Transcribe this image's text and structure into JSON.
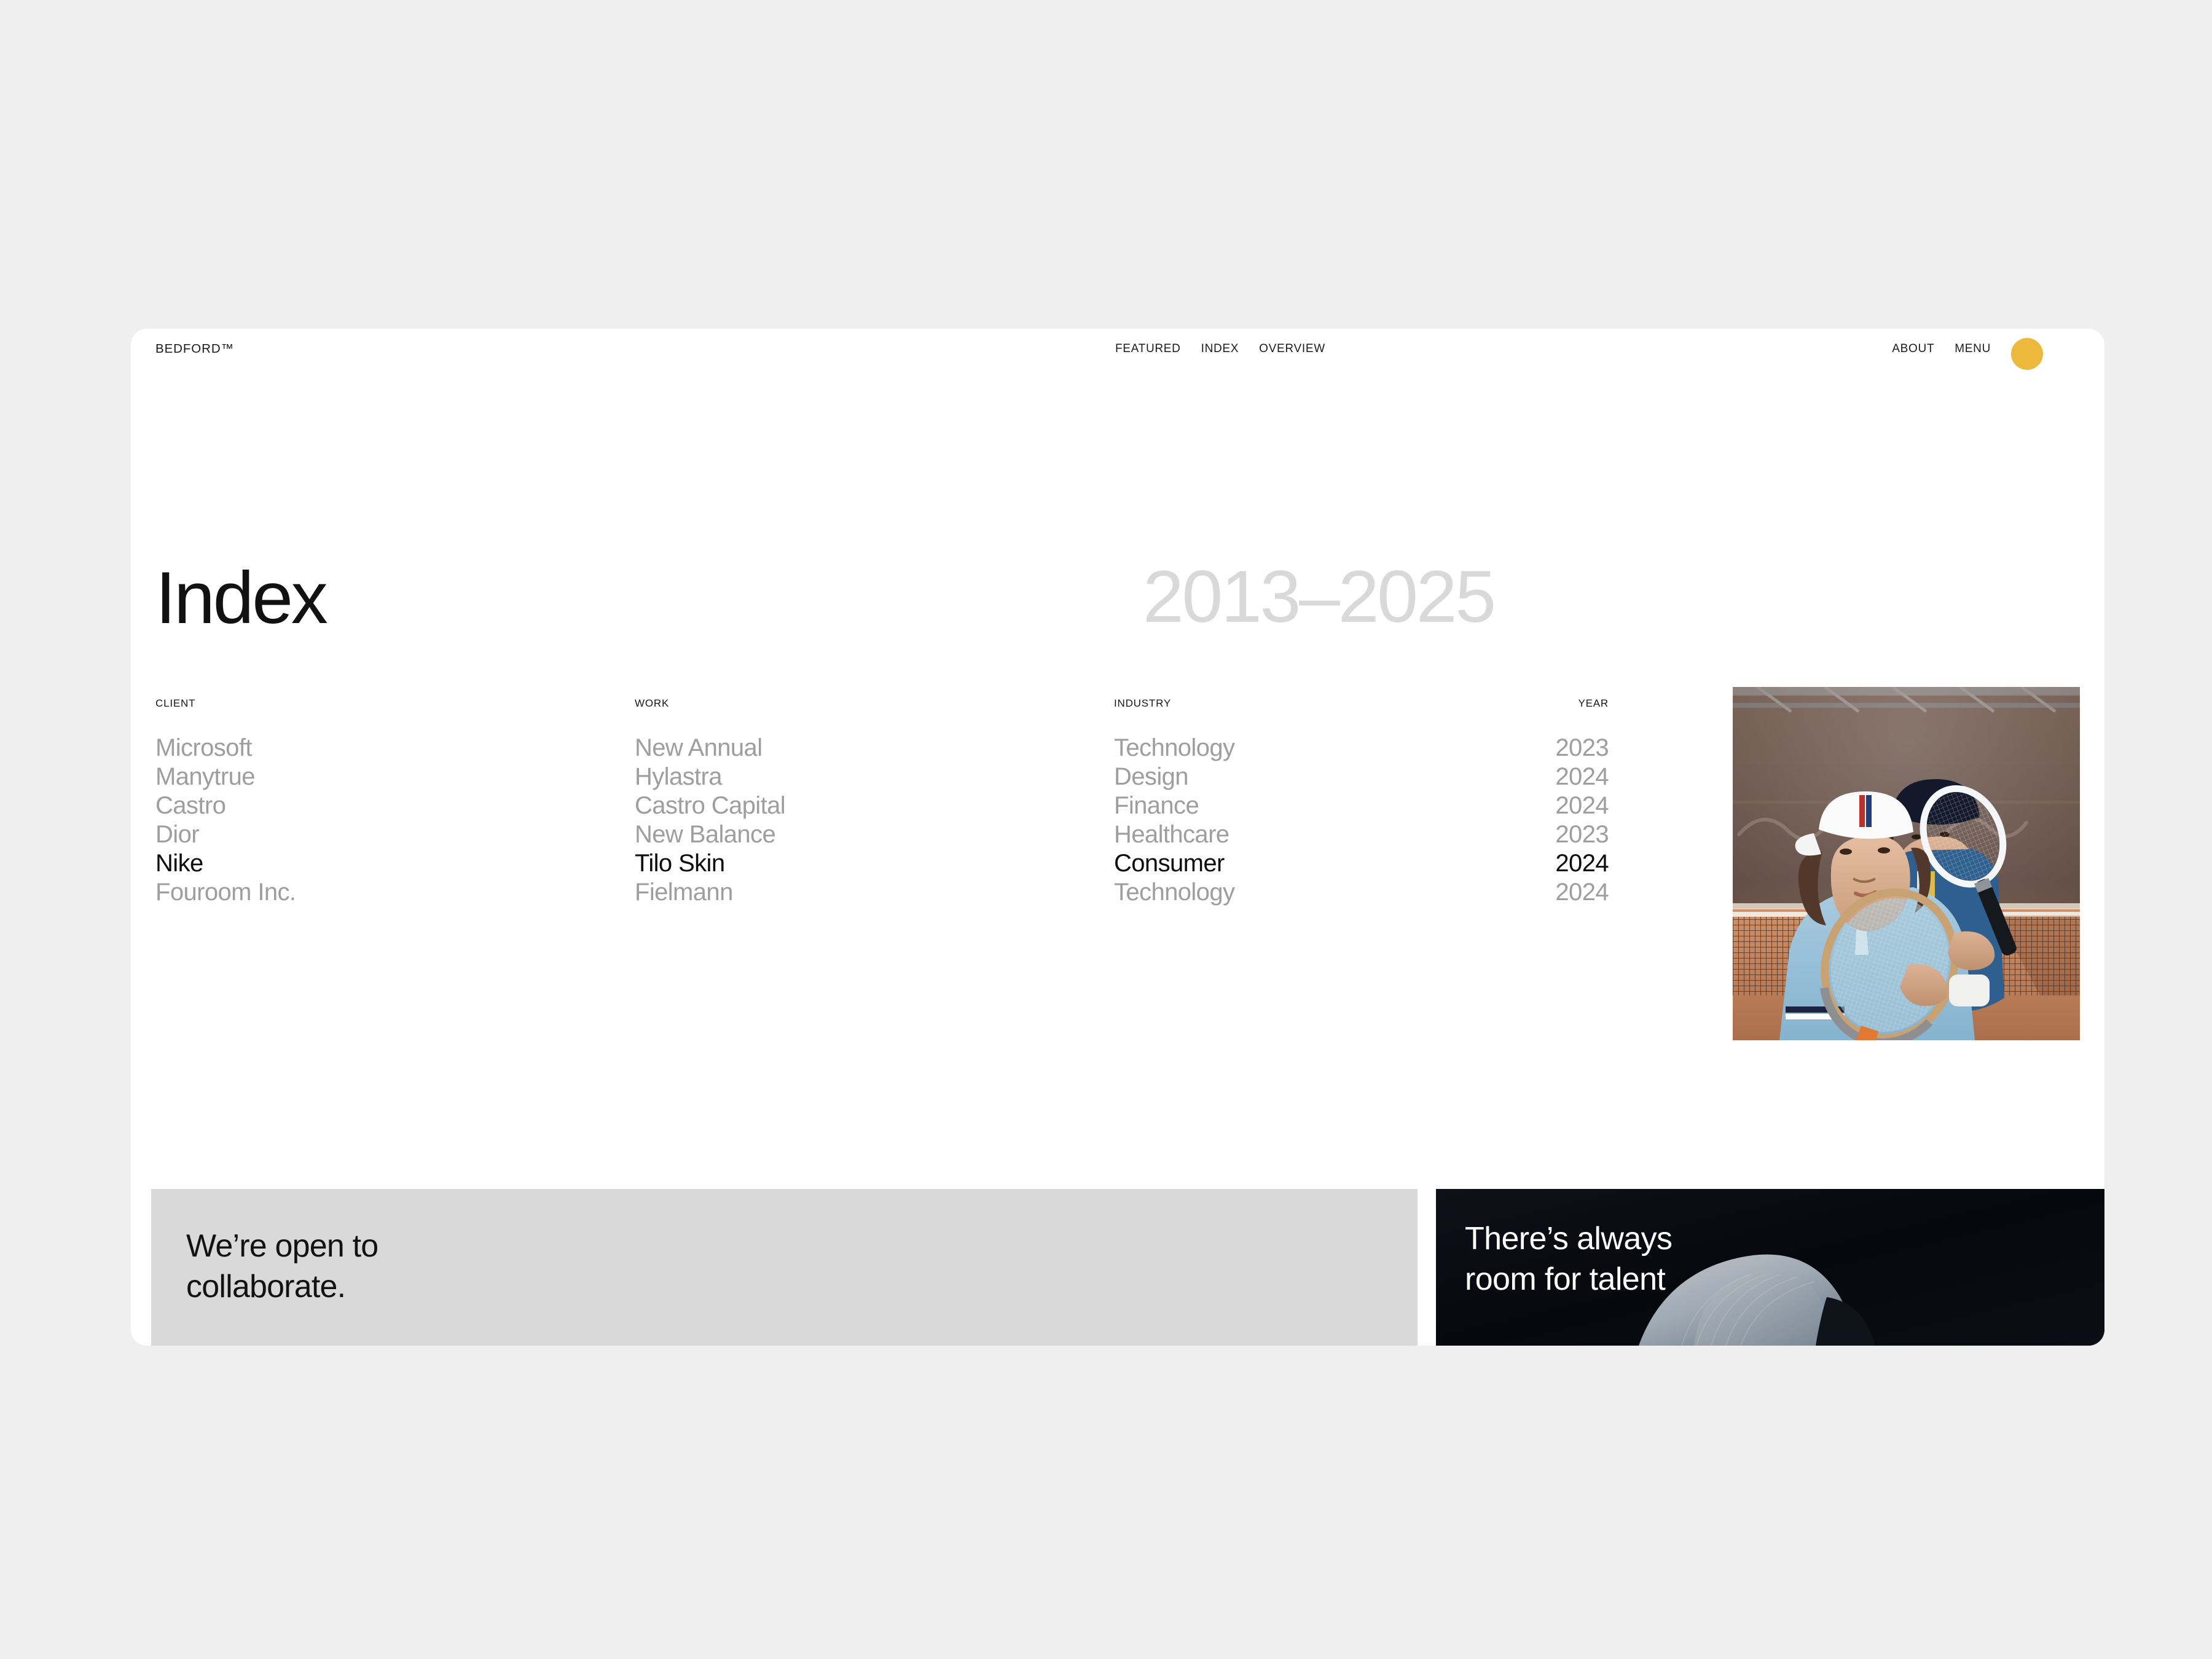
{
  "header": {
    "logo": "BEDFORD™",
    "nav_center": [
      "FEATURED",
      "INDEX",
      "OVERVIEW"
    ],
    "nav_right": [
      "ABOUT",
      "MENU"
    ],
    "dot_color": "#edb93c",
    "dot_icon": "status-dot-icon"
  },
  "hero": {
    "title": "Index",
    "year_range": "2013–2025"
  },
  "index_table": {
    "columns": [
      "CLIENT",
      "WORK",
      "INDUSTRY",
      "YEAR"
    ],
    "rows": [
      {
        "client": "Microsoft",
        "work": "New Annual",
        "industry": "Technology",
        "year": "2023",
        "active": false
      },
      {
        "client": "Manytrue",
        "work": "Hylastra",
        "industry": "Design",
        "year": "2024",
        "active": false
      },
      {
        "client": "Castro",
        "work": "Castro Capital",
        "industry": "Finance",
        "year": "2024",
        "active": false
      },
      {
        "client": "Dior",
        "work": "New Balance",
        "industry": "Healthcare",
        "year": "2023",
        "active": false
      },
      {
        "client": "Nike",
        "work": "Tilo Skin",
        "industry": "Consumer",
        "year": "2024",
        "active": true
      },
      {
        "client": "Fouroom Inc.",
        "work": "Fielmann",
        "industry": "Technology",
        "year": "2024",
        "active": false
      }
    ]
  },
  "preview_image": {
    "alt": "two tennis players on clay court holding rackets"
  },
  "panels": {
    "left": {
      "line1": "We’re open to",
      "line2": "collaborate.",
      "bg": "#d9d9d9"
    },
    "right": {
      "line1": "There’s always",
      "line2": "room for talent",
      "bg": "#0a0d12"
    }
  }
}
